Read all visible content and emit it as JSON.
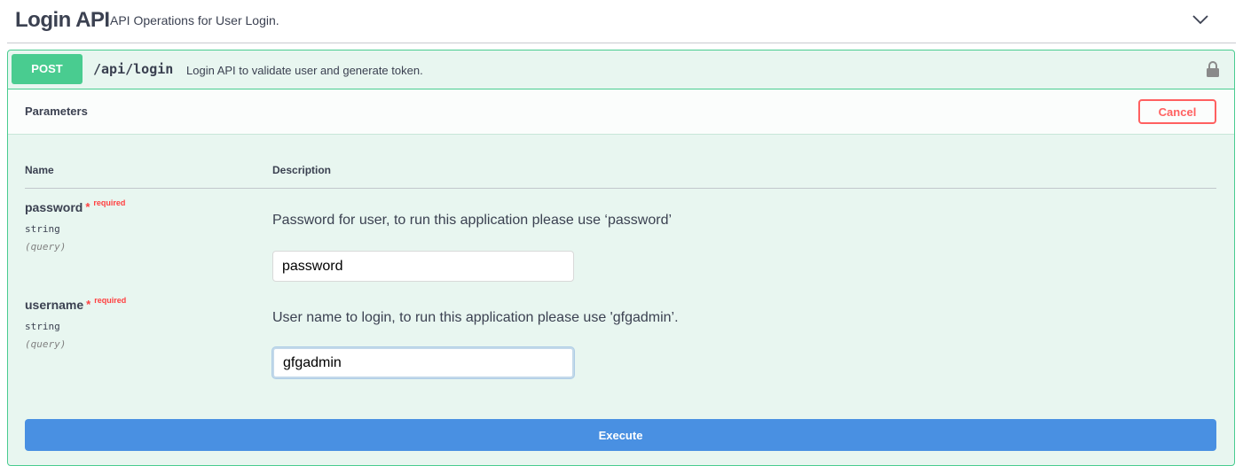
{
  "tag": {
    "title": "Login API",
    "description": "API Operations for User Login."
  },
  "operation": {
    "method": "POST",
    "path": "/api/login",
    "summary": "Login API to validate user and generate token."
  },
  "parameters_section": {
    "title": "Parameters",
    "cancel_label": "Cancel",
    "columns": {
      "name": "Name",
      "description": "Description"
    },
    "params": [
      {
        "name": "password",
        "required_star": "*",
        "required_label": "required",
        "type": "string",
        "in": "(query)",
        "description": "Password for user, to run this application please use ‘password’",
        "value": "password"
      },
      {
        "name": "username",
        "required_star": "*",
        "required_label": "required",
        "type": "string",
        "in": "(query)",
        "description": "User name to login, to run this application please use 'gfgadmin’.",
        "value": "gfgadmin"
      }
    ]
  },
  "execute_label": "Execute",
  "colors": {
    "post_green": "#49cc90",
    "cancel_red": "#ff6060",
    "execute_blue": "#4990e2"
  },
  "icons": {
    "collapse": "chevron-down-icon",
    "auth": "lock-icon"
  }
}
